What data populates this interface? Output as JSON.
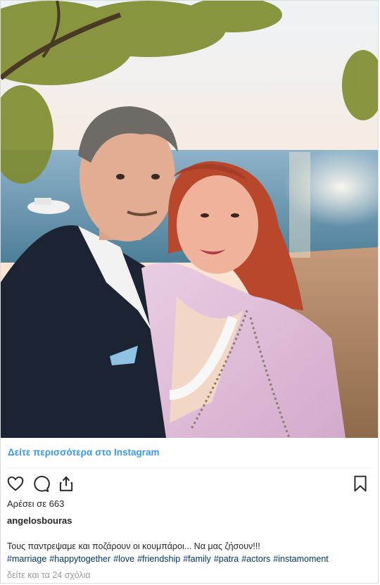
{
  "post": {
    "view_more_label": "Δείτε περισσότερα στο Instagram",
    "likes_text": "Αρέσει σε 663",
    "username": "angelosbouras",
    "caption": "Τους παντρεψαμε και ποζάρουν οι κουμπάροι... Να μας ζήσουν!!!",
    "hashtags": [
      "#marriage",
      "#happytogether",
      "#love",
      "#friendship",
      "#family",
      "#patra",
      "#actors",
      "#instamoment"
    ],
    "comments_link": "δείτε και τα 24 σχόλια"
  },
  "icons": {
    "like": "heart-icon",
    "comment": "comment-icon",
    "share": "share-icon",
    "save": "bookmark-icon"
  },
  "colors": {
    "link_blue": "#3897f0",
    "hashtag": "#003569",
    "text": "#262626",
    "muted": "#999999",
    "border": "#dbdbdb"
  }
}
